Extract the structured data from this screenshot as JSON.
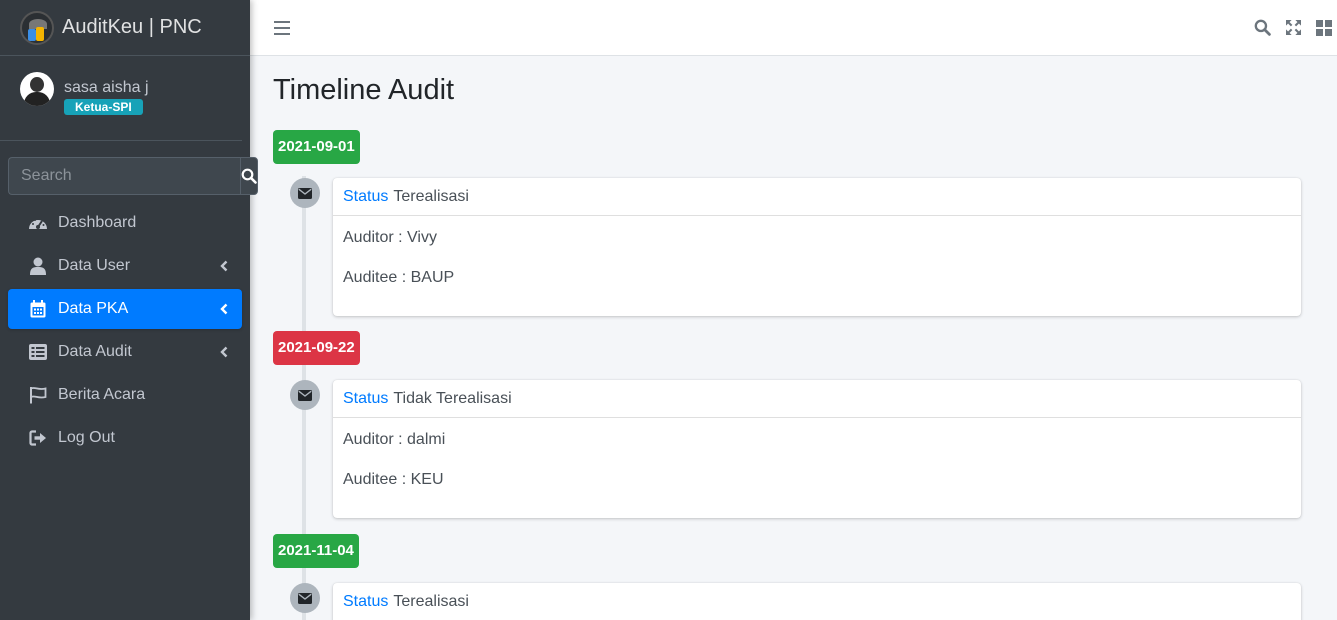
{
  "brand": {
    "name": "AuditKeu | PNC"
  },
  "user": {
    "name": "sasa aisha j",
    "role": "Ketua-SPI"
  },
  "search": {
    "placeholder": "Search"
  },
  "nav": [
    {
      "label": "Dashboard",
      "icon": "tachometer-icon",
      "has_caret": false,
      "active": false
    },
    {
      "label": "Data User",
      "icon": "user-icon",
      "has_caret": true,
      "active": false
    },
    {
      "label": "Data PKA",
      "icon": "calendar-icon",
      "has_caret": true,
      "active": true
    },
    {
      "label": "Data Audit",
      "icon": "list-icon",
      "has_caret": true,
      "active": false
    },
    {
      "label": "Berita Acara",
      "icon": "flag-icon",
      "has_caret": false,
      "active": false
    },
    {
      "label": "Log Out",
      "icon": "sign-out-icon",
      "has_caret": false,
      "active": false
    }
  ],
  "page": {
    "title": "Timeline Audit"
  },
  "timeline": [
    {
      "date": "2021-09-01",
      "date_color": "#28a745",
      "status_label": "Status",
      "status": "Terealisasi",
      "auditor": "Auditor : Vivy",
      "auditee": "Auditee : BAUP"
    },
    {
      "date": "2021-09-22",
      "date_color": "#dc3545",
      "status_label": "Status",
      "status": "Tidak Terealisasi",
      "auditor": "Auditor : dalmi",
      "auditee": "Auditee : KEU"
    },
    {
      "date": "2021-11-04",
      "date_color": "#28a745",
      "status_label": "Status",
      "status": "Terealisasi"
    }
  ],
  "colors": {
    "sidebar_bg": "#343a40",
    "active": "#007bff",
    "success": "#28a745",
    "danger": "#dc3545",
    "badge": "#17a2b8"
  }
}
